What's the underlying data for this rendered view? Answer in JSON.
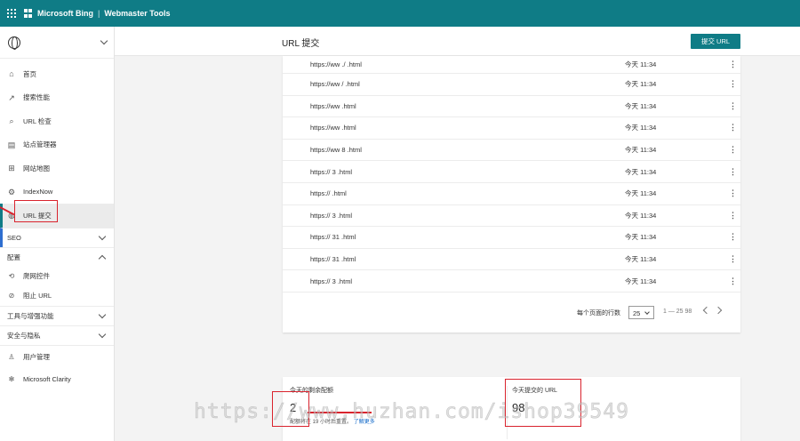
{
  "topbar": {
    "brand": "Microsoft Bing",
    "separator": "|",
    "product": "Webmaster Tools"
  },
  "sidebar": {
    "items": [
      {
        "label": "首页",
        "icon": "home-icon",
        "glyph": "⌂"
      },
      {
        "label": "搜索性能",
        "icon": "trend-icon",
        "glyph": "↗"
      },
      {
        "label": "URL 检查",
        "icon": "search-icon",
        "glyph": "⌕"
      },
      {
        "label": "站点管理器",
        "icon": "document-icon",
        "glyph": "▤"
      },
      {
        "label": "网站地图",
        "icon": "sitemap-icon",
        "glyph": "⊞"
      },
      {
        "label": "IndexNow",
        "icon": "gear-icon",
        "glyph": "⚙"
      },
      {
        "label": "URL 提交",
        "icon": "globe-icon",
        "glyph": "◍"
      }
    ],
    "groups": {
      "seo": "SEO",
      "config": "配置",
      "config_items": [
        {
          "label": "爬网控件",
          "icon": "crawl-icon",
          "glyph": "⟲"
        },
        {
          "label": "阻止 URL",
          "icon": "block-icon",
          "glyph": "⊘"
        }
      ],
      "tools": "工具与增强功能",
      "security": "安全与隐私",
      "bottom_items": [
        {
          "label": "用户管理",
          "icon": "user-icon",
          "glyph": "♙"
        },
        {
          "label": "Microsoft Clarity",
          "icon": "clarity-icon",
          "glyph": "✻"
        }
      ]
    }
  },
  "header": {
    "title": "URL 提交",
    "submit_label": "提交 URL"
  },
  "table": {
    "rows": [
      {
        "url": "https://ww                    ./  .html",
        "time": "今天 11:34"
      },
      {
        "url": "https://ww                    /  .html",
        "time": "今天 11:34"
      },
      {
        "url": "https://ww                    .html",
        "time": "今天 11:34"
      },
      {
        "url": "https://ww                    .html",
        "time": "今天 11:34"
      },
      {
        "url": "https://ww                    8 .html",
        "time": "今天 11:34"
      },
      {
        "url": "https://                    3 .html",
        "time": "今天 11:34"
      },
      {
        "url": "https://                    .html",
        "time": "今天 11:34"
      },
      {
        "url": "https://                    3 .html",
        "time": "今天 11:34"
      },
      {
        "url": "https://                    31 .html",
        "time": "今天 11:34"
      },
      {
        "url": "https://                    31 .html",
        "time": "今天 11:34"
      },
      {
        "url": "https://                    3 .html",
        "time": "今天 11:34"
      }
    ],
    "more_glyph": "⋮"
  },
  "pager": {
    "label": "每个页面的行数",
    "page_size": "25",
    "range": "1 — 25 98"
  },
  "stats": {
    "left_label": "今天的剩余配额",
    "left_value": "2",
    "left_note": "配额将在 19 小时后重置。",
    "left_link": "了解更多",
    "right_label": "今天提交的 URL",
    "right_value": "98"
  },
  "watermark": "https://www.huzhan.com/ishop39549",
  "colors": {
    "accent": "#0f7c86",
    "annotation": "#d9232d"
  }
}
